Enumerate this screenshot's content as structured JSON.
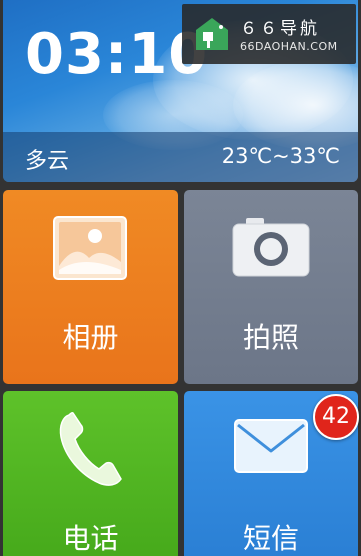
{
  "weather": {
    "time": "03:10",
    "condition": "多云",
    "temperature": "23℃~33℃"
  },
  "watermark": {
    "title": "６６导航",
    "subtitle": "66DAOHAN.COM"
  },
  "apps": [
    {
      "label": "相册",
      "icon": "photo-gallery-icon",
      "color": "#ee8322"
    },
    {
      "label": "拍照",
      "icon": "camera-icon",
      "color": "#747e90"
    },
    {
      "label": "电话",
      "icon": "phone-icon",
      "color": "#52b523"
    },
    {
      "label": "短信",
      "icon": "envelope-icon",
      "color": "#3189dd"
    }
  ],
  "sms_badge": "42",
  "colors": {
    "badge": "#e0251b",
    "weather_sky": "#2a86d8"
  }
}
